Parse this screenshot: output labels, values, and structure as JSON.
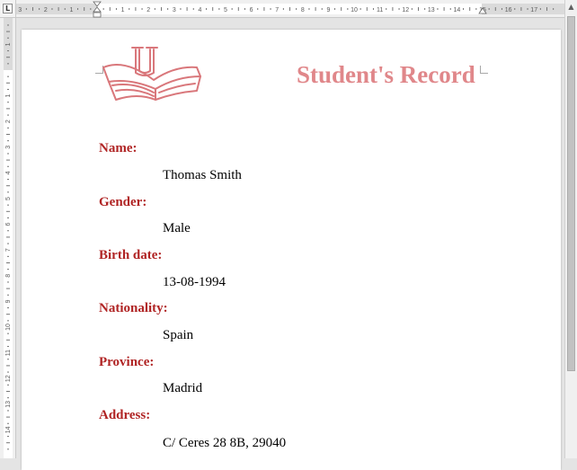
{
  "ruler": {
    "tab_selector": "L",
    "h_numbers": [
      "3",
      "2",
      "1",
      "1",
      "2",
      "3",
      "4",
      "5",
      "6",
      "7",
      "8",
      "9",
      "10",
      "11",
      "12",
      "13",
      "14",
      "15",
      "16",
      "17"
    ],
    "v_numbers": [
      "1",
      "1",
      "2",
      "3",
      "4",
      "5",
      "6",
      "7",
      "8",
      "9",
      "10",
      "11",
      "12",
      "13",
      "14"
    ]
  },
  "document": {
    "title": "Student's Record",
    "fields": [
      {
        "label": "Name:",
        "value": "Thomas Smith"
      },
      {
        "label": "Gender:",
        "value": "Male"
      },
      {
        "label": "Birth date:",
        "value": "13-08-1994"
      },
      {
        "label": "Nationality:",
        "value": "Spain"
      },
      {
        "label": "Province:",
        "value": "Madrid"
      },
      {
        "label": "Address:",
        "value": "C/ Ceres 28 8B, 29040"
      }
    ]
  },
  "colors": {
    "title": "#e0878a",
    "label": "#b02424",
    "logo": "#d9777b"
  }
}
